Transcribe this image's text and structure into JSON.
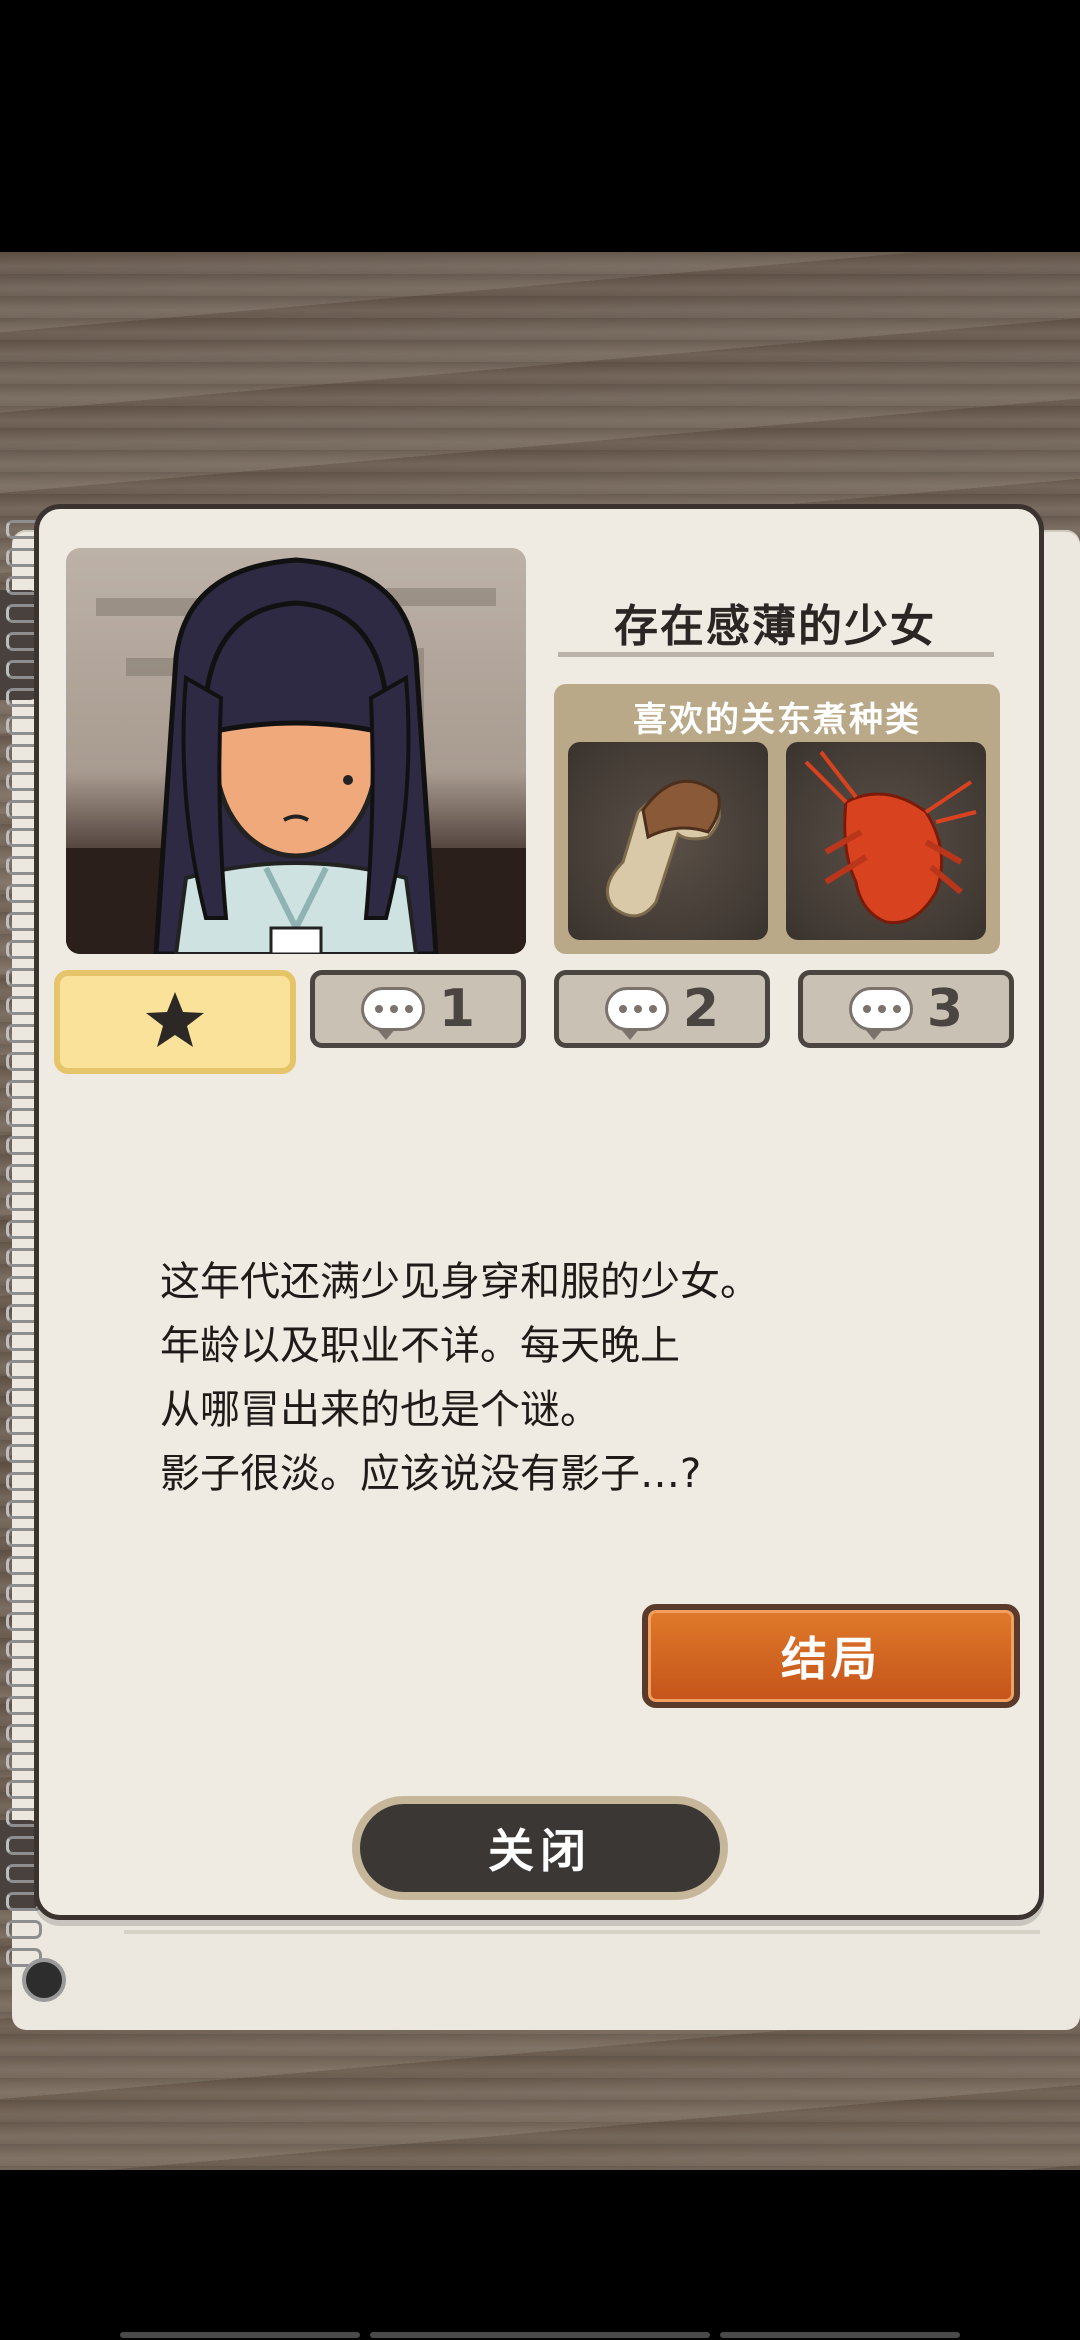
{
  "character": {
    "name": "存在感薄的少女",
    "favorite_title": "喜欢的关东煮种类",
    "favorite_foods": [
      "matsutake-mushroom",
      "spiny-lobster"
    ],
    "description_lines": [
      "这年代还满少见身穿和服的少女。",
      "年龄以及职业不详。每天晚上",
      "从哪冒出来的也是个谜。",
      "影子很淡。应该说没有影子…?"
    ]
  },
  "tabs": [
    {
      "icon": "star-icon",
      "label": ""
    },
    {
      "icon": "speech-bubble-icon",
      "label": "1"
    },
    {
      "icon": "speech-bubble-icon",
      "label": "2"
    },
    {
      "icon": "speech-bubble-icon",
      "label": "3"
    }
  ],
  "buttons": {
    "ending": "结局",
    "close": "关闭"
  },
  "colors": {
    "accent_orange": "#d0621f",
    "active_tab": "#fbe29a",
    "panel_bg": "#efebe3",
    "dark_button": "#3b3735"
  }
}
